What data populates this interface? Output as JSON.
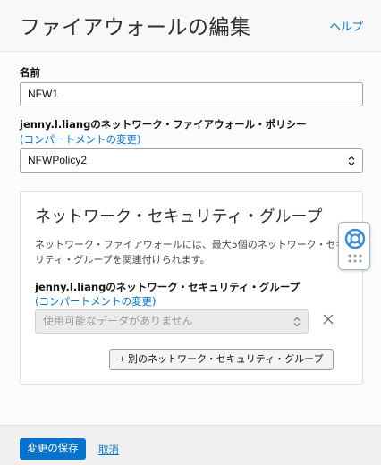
{
  "header": {
    "title": "ファイアウォールの編集",
    "help_link": "ヘルプ"
  },
  "form": {
    "name": {
      "label": "名前",
      "value": "NFW1"
    },
    "policy": {
      "label": "jenny.l.liangのネットワーク・ファイアウォール・ポリシー",
      "change_compartment": "(コンパートメントの変更)",
      "selected": "NFWPolicy2"
    },
    "nsg": {
      "title": "ネットワーク・セキュリティ・グループ",
      "description": "ネットワーク・ファイアウォールには、最大5個のネットワーク・セキュリティ・グループを関連付けられます。",
      "label": "jenny.l.liangのネットワーク・セキュリティ・グループ",
      "change_compartment": "(コンパートメントの変更)",
      "placeholder": "使用可能なデータがありません",
      "add_button": "+ 別のネットワーク・セキュリティ・グループ"
    }
  },
  "footer": {
    "save_button": "変更の保存",
    "cancel_link": "取消"
  },
  "colors": {
    "link": "#0572ce",
    "primary_button": "#0572ce",
    "help_widget_accent": "#3a8fd8"
  },
  "icons": {
    "select_arrows": "chevron-up-down-icon",
    "remove": "close-icon",
    "help_widget": "lifebuoy-icon",
    "drag_handle": "grip-dots-icon"
  }
}
